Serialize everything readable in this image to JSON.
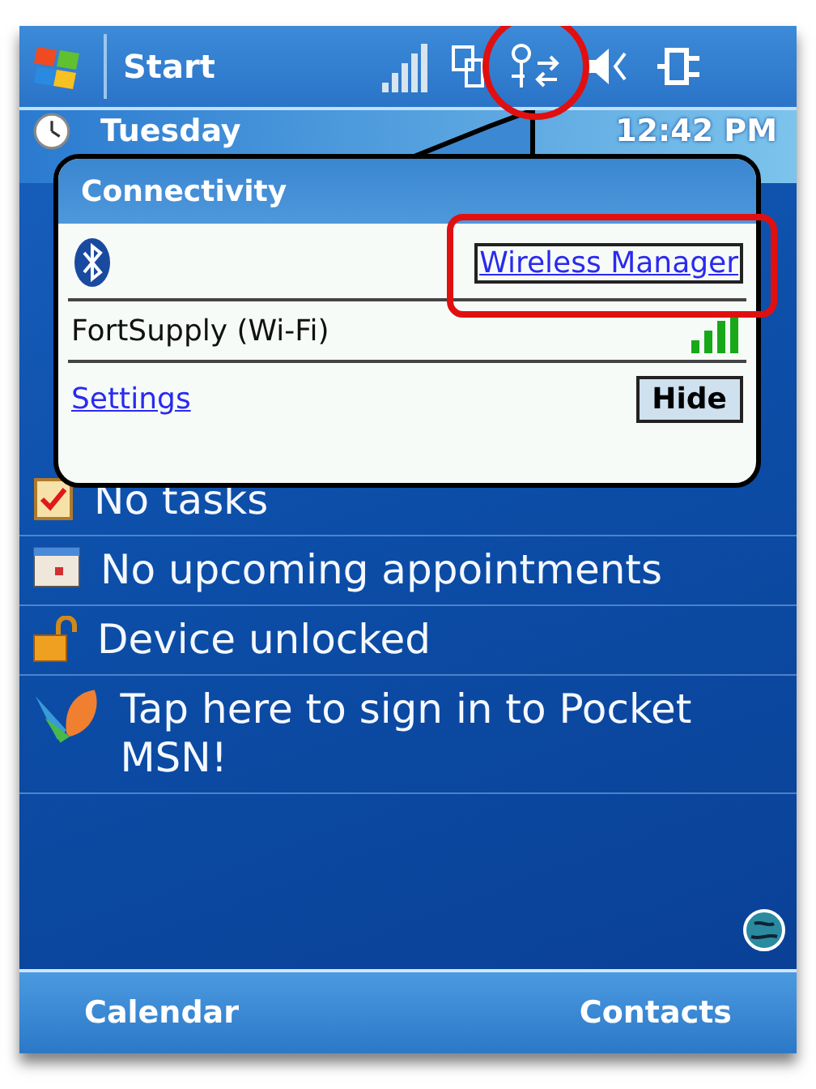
{
  "title_bar": {
    "start": "Start"
  },
  "today": {
    "day": "Tuesday",
    "time": "12:42 PM"
  },
  "items": [
    {
      "kind": "tasks",
      "text": "No tasks"
    },
    {
      "kind": "calendar",
      "text": "No upcoming appointments"
    },
    {
      "kind": "lock",
      "text": "Device unlocked"
    },
    {
      "kind": "msn",
      "text": "Tap here to sign in to Pocket MSN!"
    }
  ],
  "popup": {
    "title": "Connectivity",
    "wireless_link": "Wireless Manager",
    "network": "FortSupply (Wi-Fi)",
    "settings_link": "Settings",
    "hide_button": "Hide"
  },
  "softkeys": [
    "Calendar",
    "Contacts"
  ]
}
